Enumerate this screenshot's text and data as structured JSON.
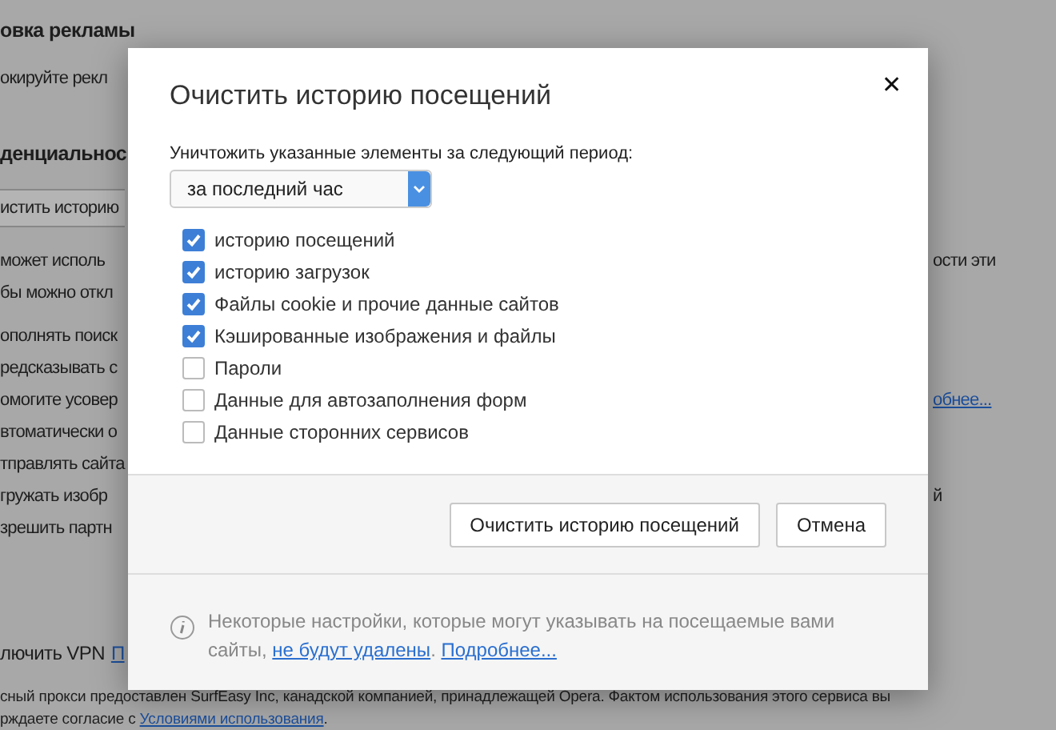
{
  "background_page": {
    "sections": [
      {
        "kind": "heading",
        "text": "овка рекламы"
      },
      {
        "kind": "line",
        "text": "окируйте рекл"
      },
      {
        "kind": "heading",
        "text": "денциальнос"
      },
      {
        "kind": "button",
        "text": "истить историю"
      },
      {
        "kind": "line",
        "text": "может исполь",
        "right": "ости эти"
      },
      {
        "kind": "line",
        "text": "бы можно откл"
      },
      {
        "kind": "line",
        "text": "ополнять поиск"
      },
      {
        "kind": "line",
        "text": "редсказывать с"
      },
      {
        "kind": "line",
        "text": "омогите усовер",
        "right_link": "обнее..."
      },
      {
        "kind": "line",
        "text": "втоматически о"
      },
      {
        "kind": "line",
        "text": "тправлять сайта"
      },
      {
        "kind": "line",
        "text": "гружать изобр",
        "right": "й"
      },
      {
        "kind": "line",
        "text": "зрешить партн"
      }
    ],
    "vpn": {
      "label": "лючить VPN",
      "link": "П"
    },
    "footer": {
      "line_1": "сный прокси предоставлен SurfEasy Inc, канадской компанией, принадлежащей Opera. Фактом использования этого сервиса вы",
      "line_2_prefix": "рждаете согласие с",
      "line_2_link": "Условиями использования",
      "line_2_suffix": "."
    }
  },
  "dialog": {
    "title": "Очистить историю посещений",
    "close": "✕",
    "period_label": "Уничтожить указанные элементы за следующий период:",
    "period_value": "за последний час",
    "options": [
      {
        "label": "историю посещений",
        "checked": true
      },
      {
        "label": "историю загрузок",
        "checked": true
      },
      {
        "label": "Файлы cookie и прочие данные сайтов",
        "checked": true
      },
      {
        "label": "Кэшированные изображения и файлы",
        "checked": true
      },
      {
        "label": "Пароли",
        "checked": false
      },
      {
        "label": "Данные для автозаполнения форм",
        "checked": false
      },
      {
        "label": "Данные сторонних сервисов",
        "checked": false
      }
    ],
    "buttons": [
      "Очистить историю посещений",
      "Отмена"
    ],
    "info": {
      "text": "Некоторые настройки, которые могут указывать на посещаемые вами сайты,",
      "link_1": "не будут удалены",
      "separator": ".",
      "link_2": "Подробнее..."
    }
  }
}
